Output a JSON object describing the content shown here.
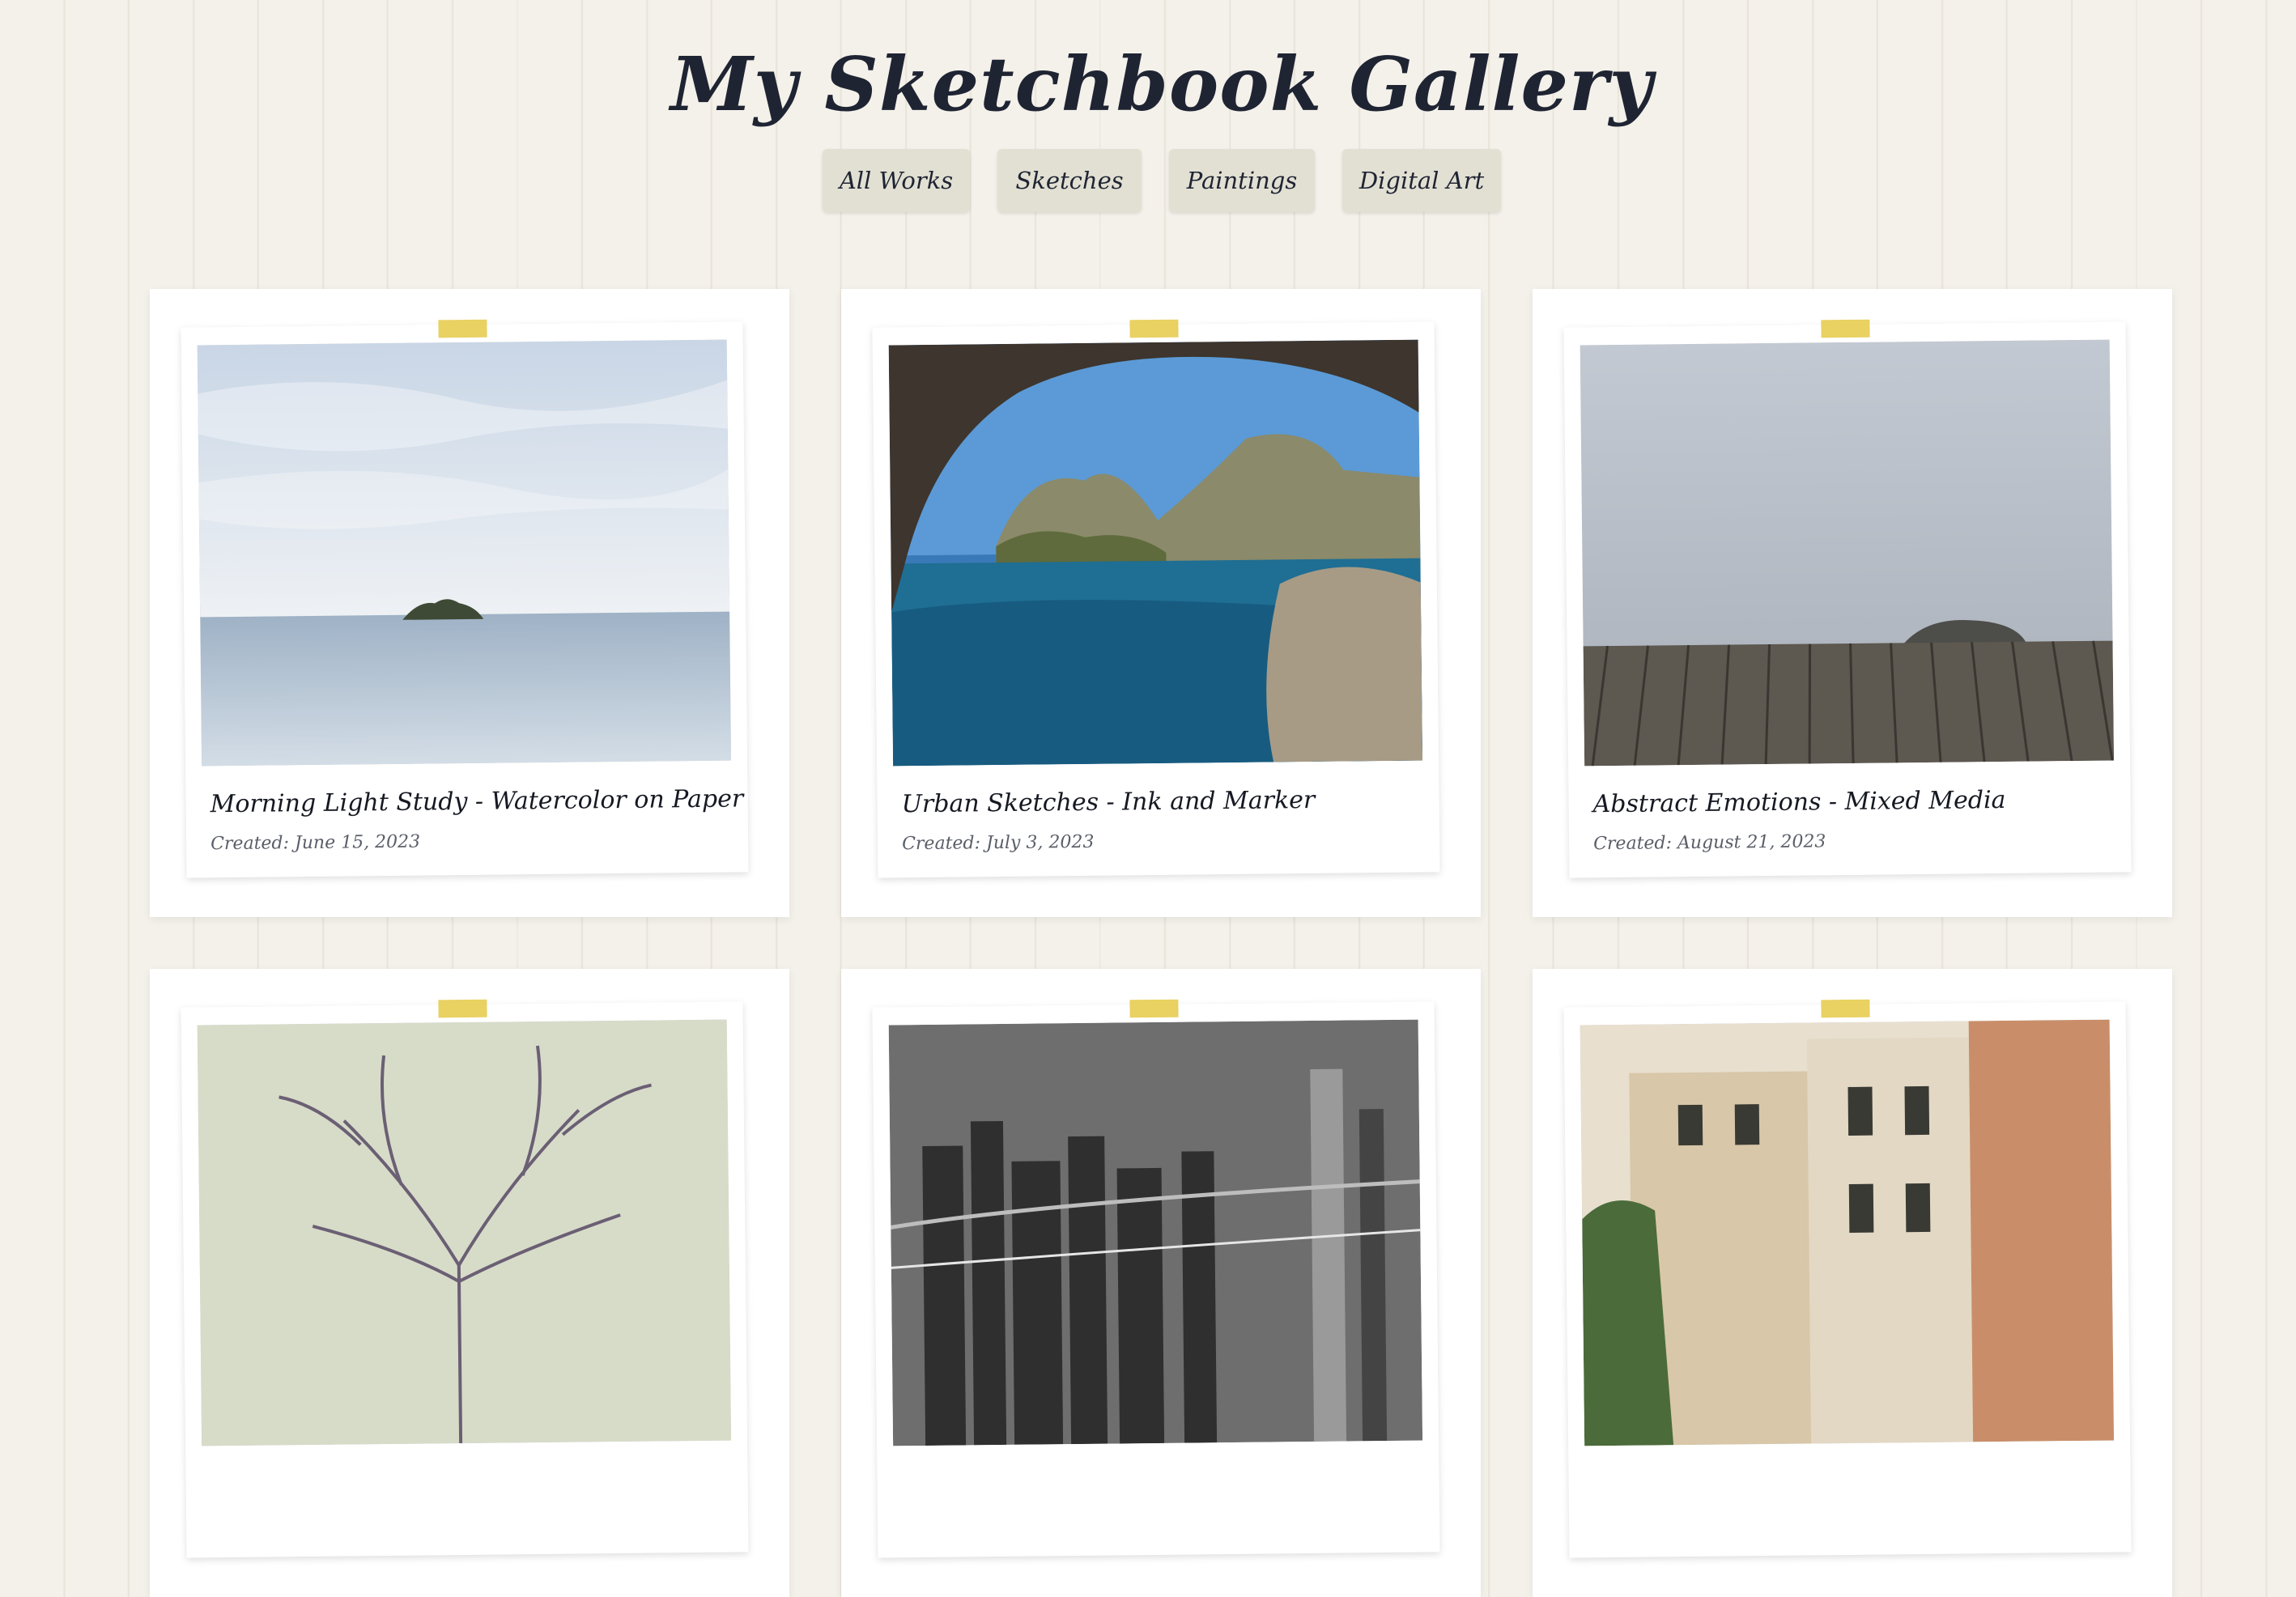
{
  "header": {
    "title": "My Sketchbook Gallery"
  },
  "filters": [
    {
      "label": "All Works"
    },
    {
      "label": "Sketches"
    },
    {
      "label": "Paintings"
    },
    {
      "label": "Digital Art"
    }
  ],
  "gallery": {
    "items": [
      {
        "title": "Morning Light Study - Watercolor on Paper",
        "date": "Created: June 15, 2023",
        "image": "calm sea with small island"
      },
      {
        "title": "Urban Sketches - Ink and Marker",
        "date": "Created: July 3, 2023",
        "image": "sea cave view of cliffs and blue water"
      },
      {
        "title": "Abstract Emotions - Mixed Media",
        "date": "Created: August 21, 2023",
        "image": "foggy wooden pier with rock"
      },
      {
        "title": "",
        "date": "",
        "image": "bare tree"
      },
      {
        "title": "",
        "date": "",
        "image": "black and white city bridge at night"
      },
      {
        "title": "",
        "date": "",
        "image": "old european buildings"
      }
    ]
  },
  "colors": {
    "background": "#f4f1ea",
    "filter_button": "#e2e0d3",
    "tape": "#e8cf5a",
    "text": "#1f2433"
  }
}
